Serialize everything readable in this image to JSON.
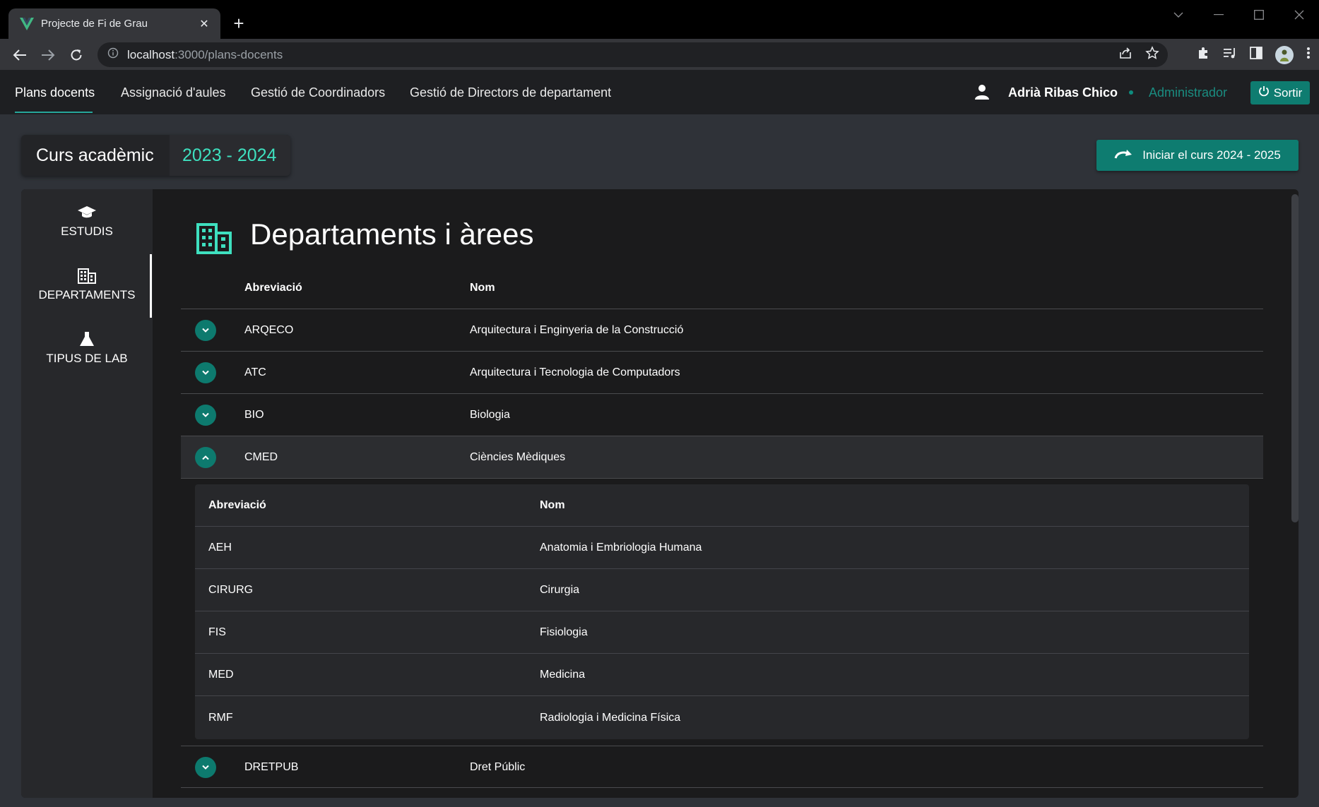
{
  "browser": {
    "tab_title": "Projecte de Fi de Grau",
    "url_host": "localhost",
    "url_rest": ":3000/plans-docents",
    "window_controls": [
      "chevron-down-icon",
      "minimize-icon",
      "maximize-icon",
      "close-icon"
    ]
  },
  "nav": {
    "items": [
      "Plans docents",
      "Assignació d'aules",
      "Gestió de Coordinadors",
      "Gestió de Directors de departament"
    ],
    "active_index": 0,
    "user_name": "Adrià Ribas Chico",
    "role": "Administrador",
    "logout_label": "Sortir"
  },
  "course": {
    "label": "Curs acadèmic",
    "year": "2023 - 2024",
    "start_button": "Iniciar el curs 2024 - 2025"
  },
  "sidebar": {
    "items": [
      {
        "label": "ESTUDIS",
        "icon": "graduation-cap-icon"
      },
      {
        "label": "DEPARTAMENTS",
        "icon": "building-icon"
      },
      {
        "label": "TIPUS DE LAB",
        "icon": "flask-icon"
      }
    ],
    "active_index": 1
  },
  "page": {
    "title": "Departaments i àrees",
    "columns": {
      "abbr": "Abreviació",
      "name": "Nom"
    }
  },
  "departments": [
    {
      "abbr": "ARQECO",
      "name": "Arquitectura i Enginyeria de la Construcció",
      "expanded": false
    },
    {
      "abbr": "ATC",
      "name": "Arquitectura i Tecnologia de Computadors",
      "expanded": false
    },
    {
      "abbr": "BIO",
      "name": "Biologia",
      "expanded": false
    },
    {
      "abbr": "CMED",
      "name": "Ciències Mèdiques",
      "expanded": true
    },
    {
      "abbr": "DRETPUB",
      "name": "Dret Públic",
      "expanded": false
    }
  ],
  "areas": {
    "columns": {
      "abbr": "Abreviació",
      "name": "Nom"
    },
    "rows": [
      {
        "abbr": "AEH",
        "name": "Anatomia i Embriologia Humana"
      },
      {
        "abbr": "CIRURG",
        "name": "Cirurgia"
      },
      {
        "abbr": "FIS",
        "name": "Fisiologia"
      },
      {
        "abbr": "MED",
        "name": "Medicina"
      },
      {
        "abbr": "RMF",
        "name": "Radiologia i Medicina Física"
      }
    ]
  },
  "colors": {
    "accent": "#0e7c70",
    "accent_text": "#3ee0bf",
    "role_text": "#1a8c80"
  }
}
